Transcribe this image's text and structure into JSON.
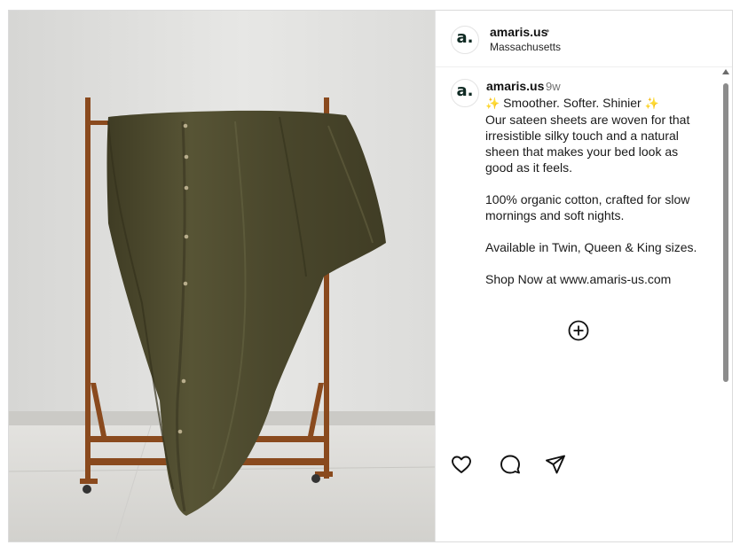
{
  "post": {
    "username": "amaris.us",
    "separator_dot": "•",
    "location": "Massachusetts",
    "avatar_letter": "a.",
    "image_icon": "bedsheet-on-rack-photo"
  },
  "caption": {
    "username": "amaris.us",
    "time_ago": "9w",
    "headline": "Smoother. Softer. Shinier",
    "sparkle": "✨",
    "body": "Our sateen sheets are woven for that irresistible silky touch and a natural sheen that makes your bed look as good as it feels.",
    "material": "100% organic cotton, crafted for slow mornings and soft nights.",
    "sizes": "Available in Twin, Queen & King sizes.",
    "shop": "Shop Now at www.amaris-us.com"
  },
  "icons": {
    "more_comments": "plus-circle-icon",
    "like": "heart-icon",
    "comment": "comment-icon",
    "share": "send-icon"
  },
  "colors": {
    "sheet": "#4d4a2e",
    "rack": "#8e4a1f",
    "wall": "#e2e2e0",
    "floor": "#d9d8d4"
  }
}
